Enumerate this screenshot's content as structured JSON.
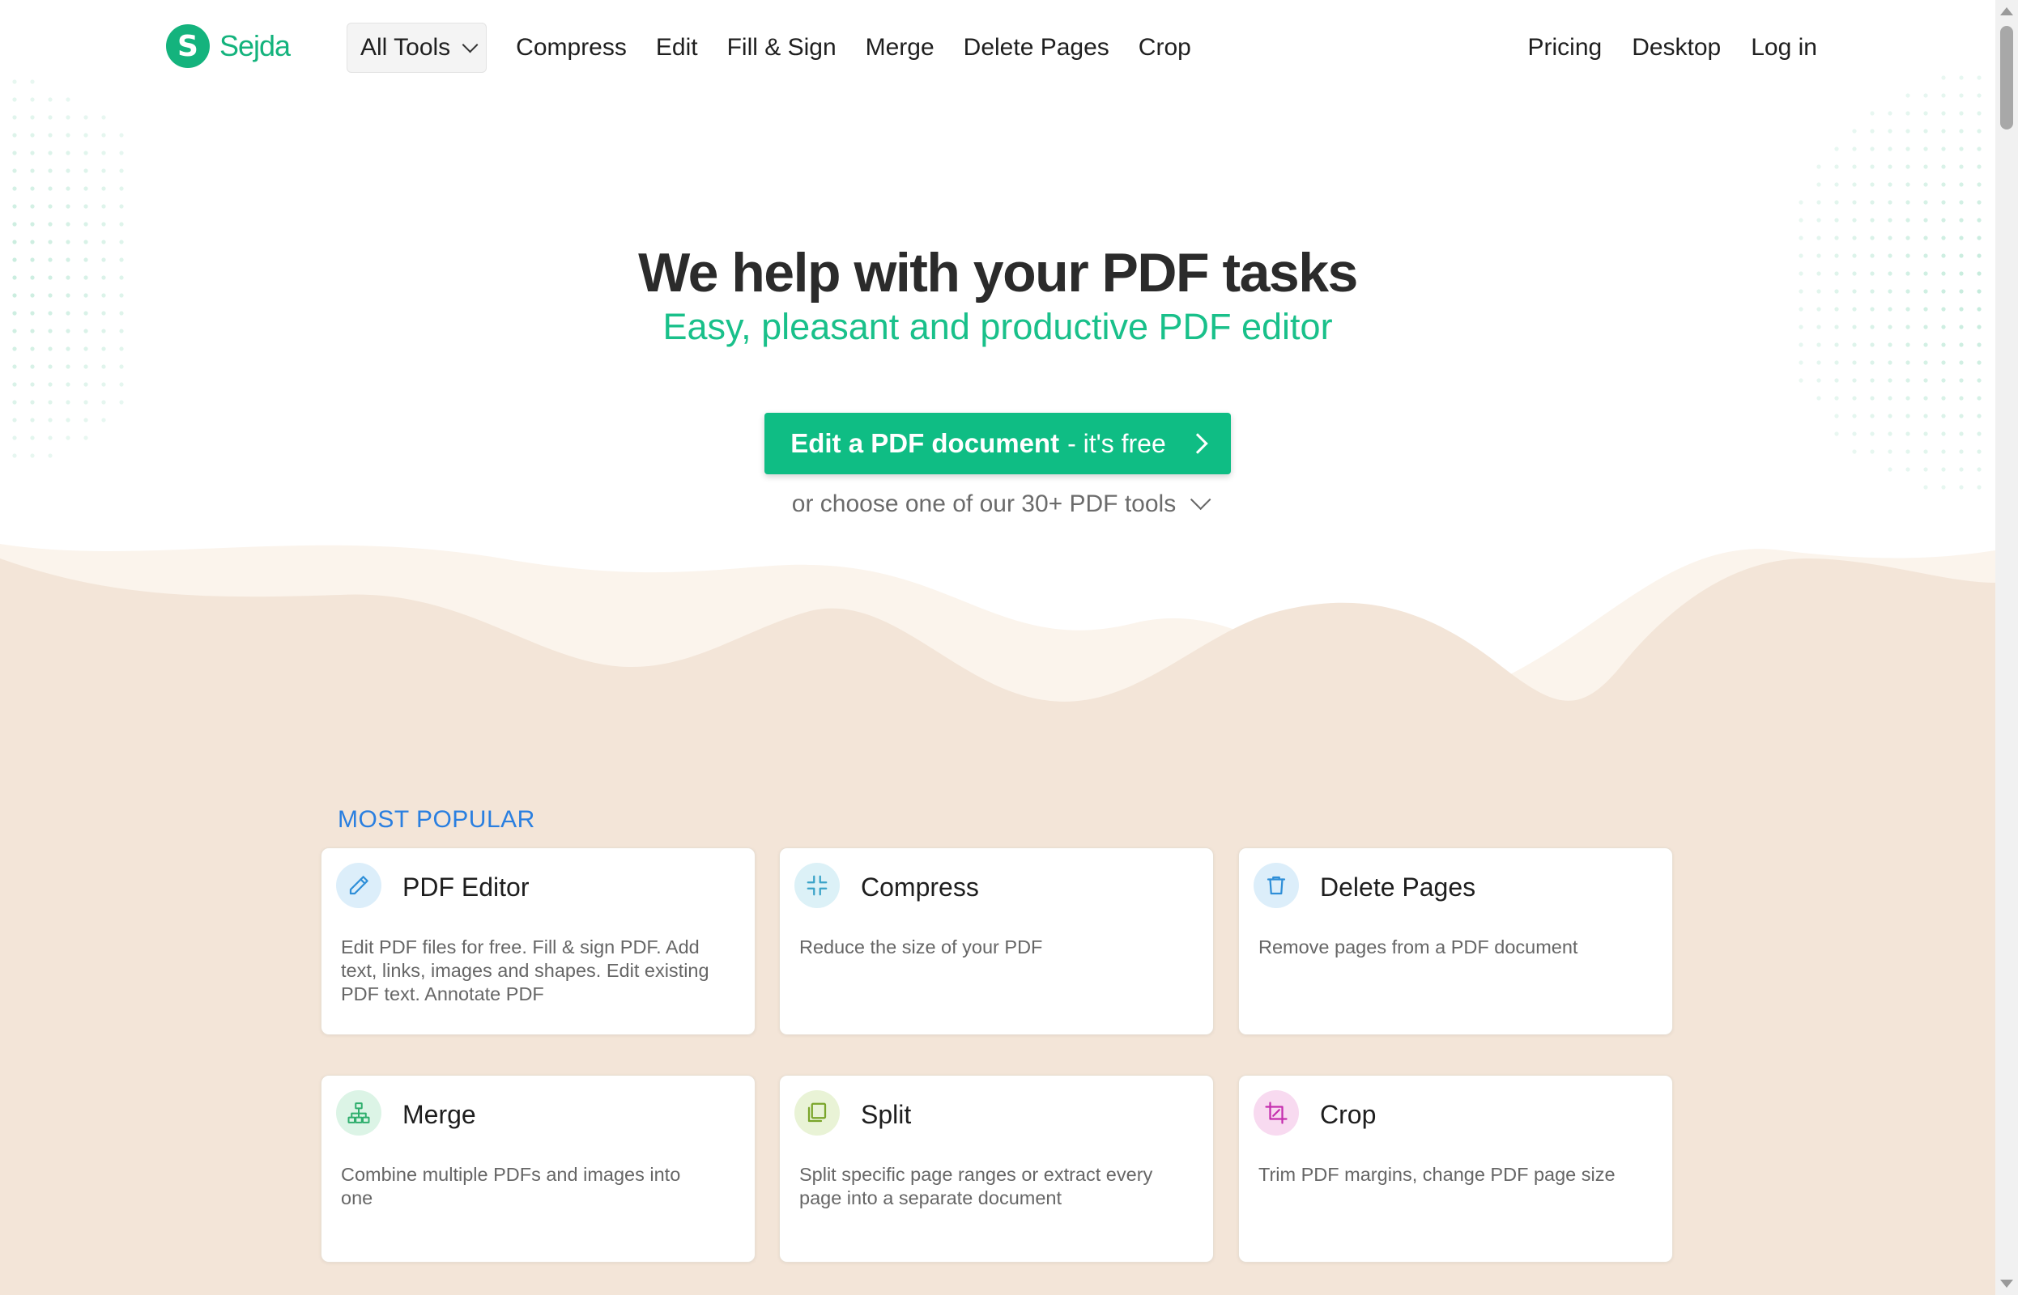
{
  "brand": {
    "mark": "S",
    "name": "Sejda"
  },
  "nav": {
    "all_tools": "All Tools",
    "links": [
      "Compress",
      "Edit",
      "Fill & Sign",
      "Merge",
      "Delete Pages",
      "Crop"
    ],
    "right": [
      "Pricing",
      "Desktop",
      "Log in"
    ]
  },
  "hero": {
    "title": "We help with your PDF tasks",
    "subtitle": "Easy, pleasant and productive PDF editor",
    "cta_strong": "Edit a PDF document",
    "cta_light": "- it's free",
    "more_tools": "or choose one of our 30+ PDF tools"
  },
  "popular": {
    "label": "MOST POPULAR",
    "cards": [
      {
        "title": "PDF Editor",
        "desc": "Edit PDF files for free. Fill & sign PDF. Add text, links, images and shapes. Edit existing PDF text. Annotate PDF",
        "icon": "pencil-icon",
        "color": "#2f8fd8",
        "bg": "#dceefa"
      },
      {
        "title": "Compress",
        "desc": "Reduce the size of your PDF",
        "icon": "compress-icon",
        "color": "#3aa3c8",
        "bg": "#dcf1f7"
      },
      {
        "title": "Delete Pages",
        "desc": "Remove pages from a PDF document",
        "icon": "trash-icon",
        "color": "#2f8fd8",
        "bg": "#dceefa"
      },
      {
        "title": "Merge",
        "desc": "Combine multiple PDFs and images into one",
        "icon": "merge-icon",
        "color": "#2fae6d",
        "bg": "#dcf4e6"
      },
      {
        "title": "Split",
        "desc": "Split specific page ranges or extract every page into a separate document",
        "icon": "split-icon",
        "color": "#7aa52a",
        "bg": "#e9f3d6"
      },
      {
        "title": "Crop",
        "desc": "Trim PDF margins, change PDF page size",
        "icon": "crop-icon",
        "color": "#c52fae",
        "bg": "#f8daf0"
      }
    ]
  },
  "colors": {
    "accent": "#14b37d",
    "wave_back": "#fbf4ec",
    "wave_front": "#f3e5d8",
    "link_blue": "#2a7fe0"
  }
}
